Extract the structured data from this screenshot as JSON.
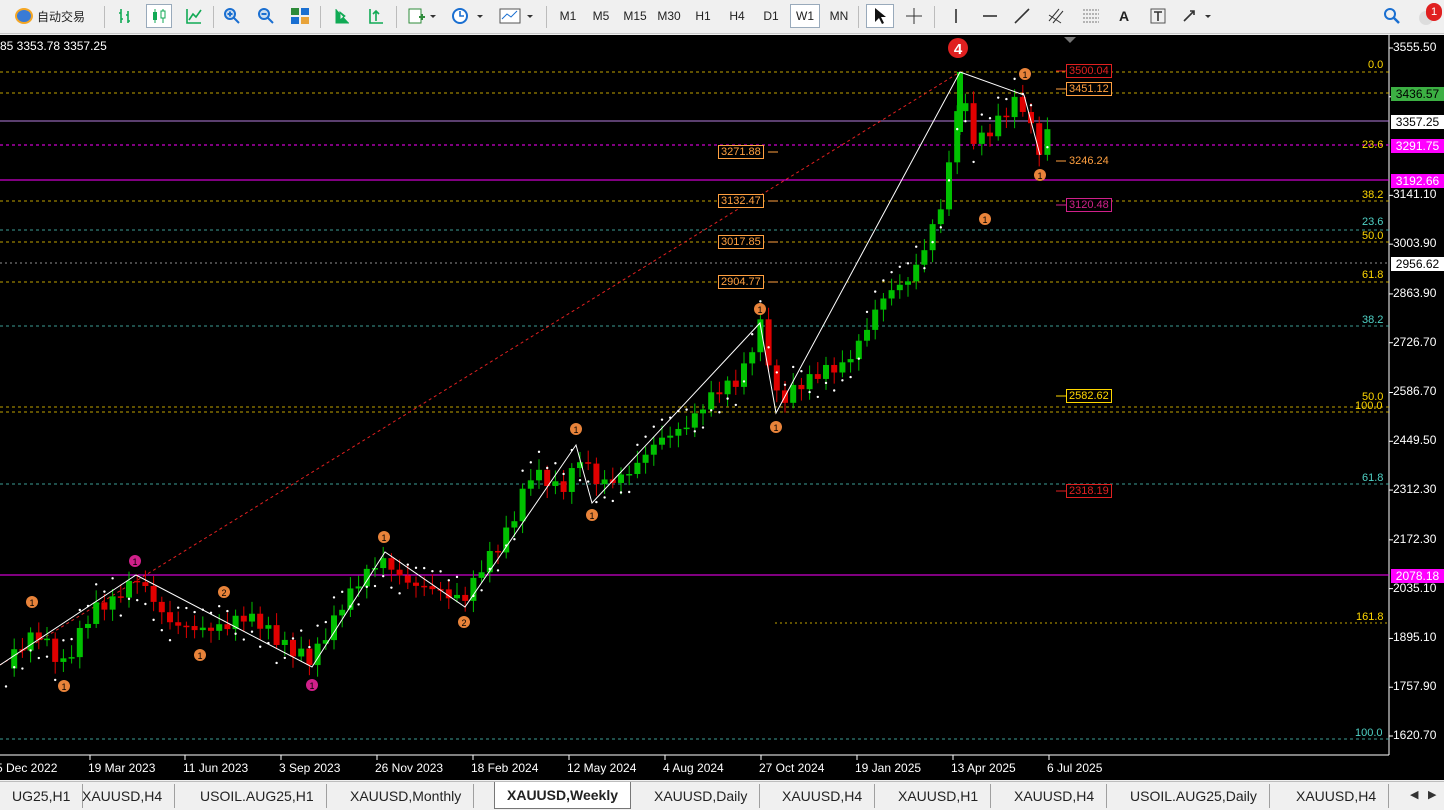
{
  "toolbar": {
    "autotrade_label": "自动交易",
    "timeframes": [
      "M1",
      "M5",
      "M15",
      "M30",
      "H1",
      "H4",
      "D1",
      "W1",
      "MN"
    ],
    "active_timeframe": "W1",
    "text_tool": "A",
    "alert_badge": "1"
  },
  "chart": {
    "ohlc_text": "85 3353.78 3357.25",
    "wave_label": "4",
    "price_axis": [
      "3555.50",
      "3418.30",
      "3141.10",
      "3003.90",
      "2863.90",
      "2726.70",
      "2586.70",
      "2449.50",
      "2312.30",
      "2172.30",
      "2035.10",
      "1895.10",
      "1757.90",
      "1620.70"
    ],
    "price_tags": {
      "green": "3436.57",
      "current": "3357.25",
      "magenta_1": "3291.75",
      "magenta_2": "3192.66",
      "white_1": "2956.62",
      "magenta_3": "2078.18"
    },
    "date_axis": [
      "5 Dec 2022",
      "19 Mar 2023",
      "11 Jun 2023",
      "3 Sep 2023",
      "26 Nov 2023",
      "18 Feb 2024",
      "12 May 2024",
      "4 Aug 2024",
      "27 Oct 2024",
      "19 Jan 2025",
      "13 Apr 2025",
      "6 Jul 2025"
    ],
    "levels_left": [
      "3271.88",
      "3132.47",
      "3017.85",
      "2904.77"
    ],
    "levels_right": [
      "3500.04",
      "3451.12",
      "3246.24",
      "3120.48",
      "2582.62",
      "2318.19"
    ],
    "fib_labels": [
      "0.0",
      "23.6",
      "38.2",
      "23.6",
      "50.0",
      "61.8",
      "38.2",
      "50.0",
      "100.0",
      "61.8",
      "161.8",
      "100.0"
    ],
    "wave_markers": [
      "1",
      "1",
      "1",
      "2",
      "1",
      "1",
      "1",
      "2",
      "1",
      "1",
      "1",
      "1",
      "1",
      "1",
      "1",
      "1",
      "1"
    ],
    "colors": {
      "bull": "#00c000",
      "bear": "#e00000",
      "fib": "#ffd700",
      "magenta": "#ff00ff",
      "teal": "#4fd1c5"
    }
  },
  "tabs": [
    "UG25,H1",
    "XAUUSD,H4",
    "USOIL.AUG25,H1",
    "XAUUSD,Monthly",
    "XAUUSD,Weekly",
    "XAUUSD,Daily",
    "XAUUSD,H4",
    "XAUUSD,H1",
    "XAUUSD,H4",
    "USOIL.AUG25,Daily",
    "XAUUSD,H4"
  ],
  "active_tab": "XAUUSD,Weekly"
}
